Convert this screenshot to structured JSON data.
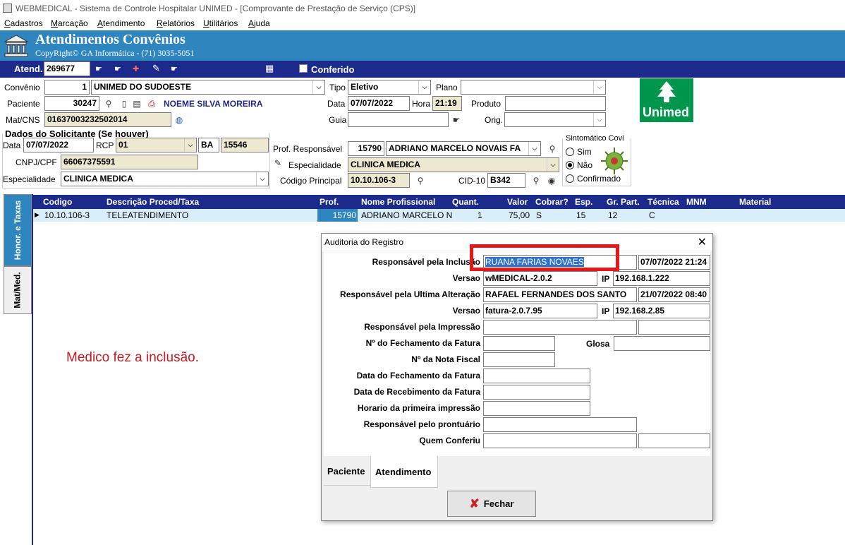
{
  "window": {
    "title": "WEBMEDICAL - Sistema de Controle Hospitalar UNIMED - [Comprovante de Prestação de Serviço  (CPS)]"
  },
  "menu": [
    "Cadastros",
    "Marcação",
    "Atendimento",
    "Relatórios",
    "Utilitários",
    "Ajuda"
  ],
  "header": {
    "title": "Atendimentos Convênios",
    "subtitle": "CopyRight© GA Informática - (71) 3035-5051"
  },
  "atend": {
    "label": "Atend.",
    "value": "269677",
    "conferido_label": "Conferido"
  },
  "form": {
    "convenio_label": "Convênio",
    "convenio_code": "1",
    "convenio_name": "UNIMED DO SUDOESTE",
    "tipo_label": "Tipo",
    "tipo_value": "Eletivo",
    "plano_label": "Plano",
    "paciente_label": "Paciente",
    "paciente_code": "30247",
    "paciente_name": "NOEME SILVA MOREIRA",
    "data_label": "Data",
    "data_value": "07/07/2022",
    "hora_label": "Hora",
    "hora_value": "21:19",
    "produto_label": "Produto",
    "mat_label": "Mat/CNS",
    "mat_value": "01637003232502014",
    "guia_label": "Guia",
    "orig_label": "Orig.",
    "solicitante_title": "Dados do Solicitante (Se houver)",
    "sol_data_label": "Data",
    "sol_data_value": "07/07/2022",
    "rcp_label": "RCP",
    "rcp_value": "01",
    "uf_value": "BA",
    "crm_value": "15546",
    "cnpj_label": "CNPJ/CPF",
    "cnpj_value": "66067375591",
    "esp_label": "Especialidade",
    "esp_value": "CLINICA MEDICA",
    "prof_label": "Prof. Responsável",
    "prof_code": "15790",
    "prof_name": "ADRIANO MARCELO NOVAIS FA",
    "esp2_label": "Especialidade",
    "esp2_value": "CLINICA MEDICA",
    "cod_label": "Código Principal",
    "cod_value": "10.10.106-3",
    "cid_label": "CID-10",
    "cid_value": "B342",
    "sintomatico_label": "Sintomático Covi",
    "sim_label": "Sim",
    "nao_label": "Não",
    "confirmado_label": "Confirmado"
  },
  "logo": {
    "text": "Unimed",
    "color": "#00964b"
  },
  "tabs": {
    "honor": "Honor. e Taxas",
    "mat": "Mat/Med."
  },
  "grid": {
    "headers": [
      "Codigo",
      "Descrição Proced/Taxa",
      "Prof.",
      "Nome Profissional",
      "Quant.",
      "Valor",
      "Cobrar?",
      "Esp.",
      "Gr. Part.",
      "Técnica",
      "MNM",
      "Material"
    ],
    "row": [
      "10.10.106-3",
      "TELEATENDIMENTO",
      "15790",
      "ADRIANO MARCELO N",
      "1",
      "75,00",
      "S",
      "15",
      "12",
      "C",
      "",
      ""
    ]
  },
  "dialog": {
    "title": "Auditoria do Registro",
    "resp_inclusao_label": "Responsável pela Inclusão",
    "resp_inclusao_value": "RUANA FARIAS NOVAES",
    "resp_inclusao_date": "07/07/2022 21:24",
    "versao_label": "Versao",
    "versao1_value": "wMEDICAL-2.0.2",
    "ip_label": "IP",
    "ip1_value": "192.168.1.222",
    "resp_alt_label": "Responsável pela Ultima Alteração",
    "resp_alt_value": "RAFAEL FERNANDES DOS SANTO",
    "resp_alt_date": "21/07/2022 08:40",
    "versao2_value": "fatura-2.0.7.95",
    "ip2_value": "192.168.2.85",
    "resp_imp_label": "Responsável pela Impressão",
    "fechamento_label": "Nº do Fechamento da Fatura",
    "glosa_label": "Glosa",
    "nota_label": "Nº da Nota Fiscal",
    "data_fech_label": "Data do Fechamento da Fatura",
    "data_rec_label": "Data de Recebimento da Fatura",
    "horario_label": "Horario da primeira impressão",
    "prontuario_label": "Responsável pelo prontuário",
    "conferiu_label": "Quem Conferiu",
    "tab_paciente": "Paciente",
    "tab_atendimento": "Atendimento",
    "fechar": "Fechar"
  },
  "annotation": "Medico fez a inclusão.",
  "colors": {
    "header": "#2f85be",
    "bar": "#1c2a8c",
    "highlight": "#e41818"
  }
}
